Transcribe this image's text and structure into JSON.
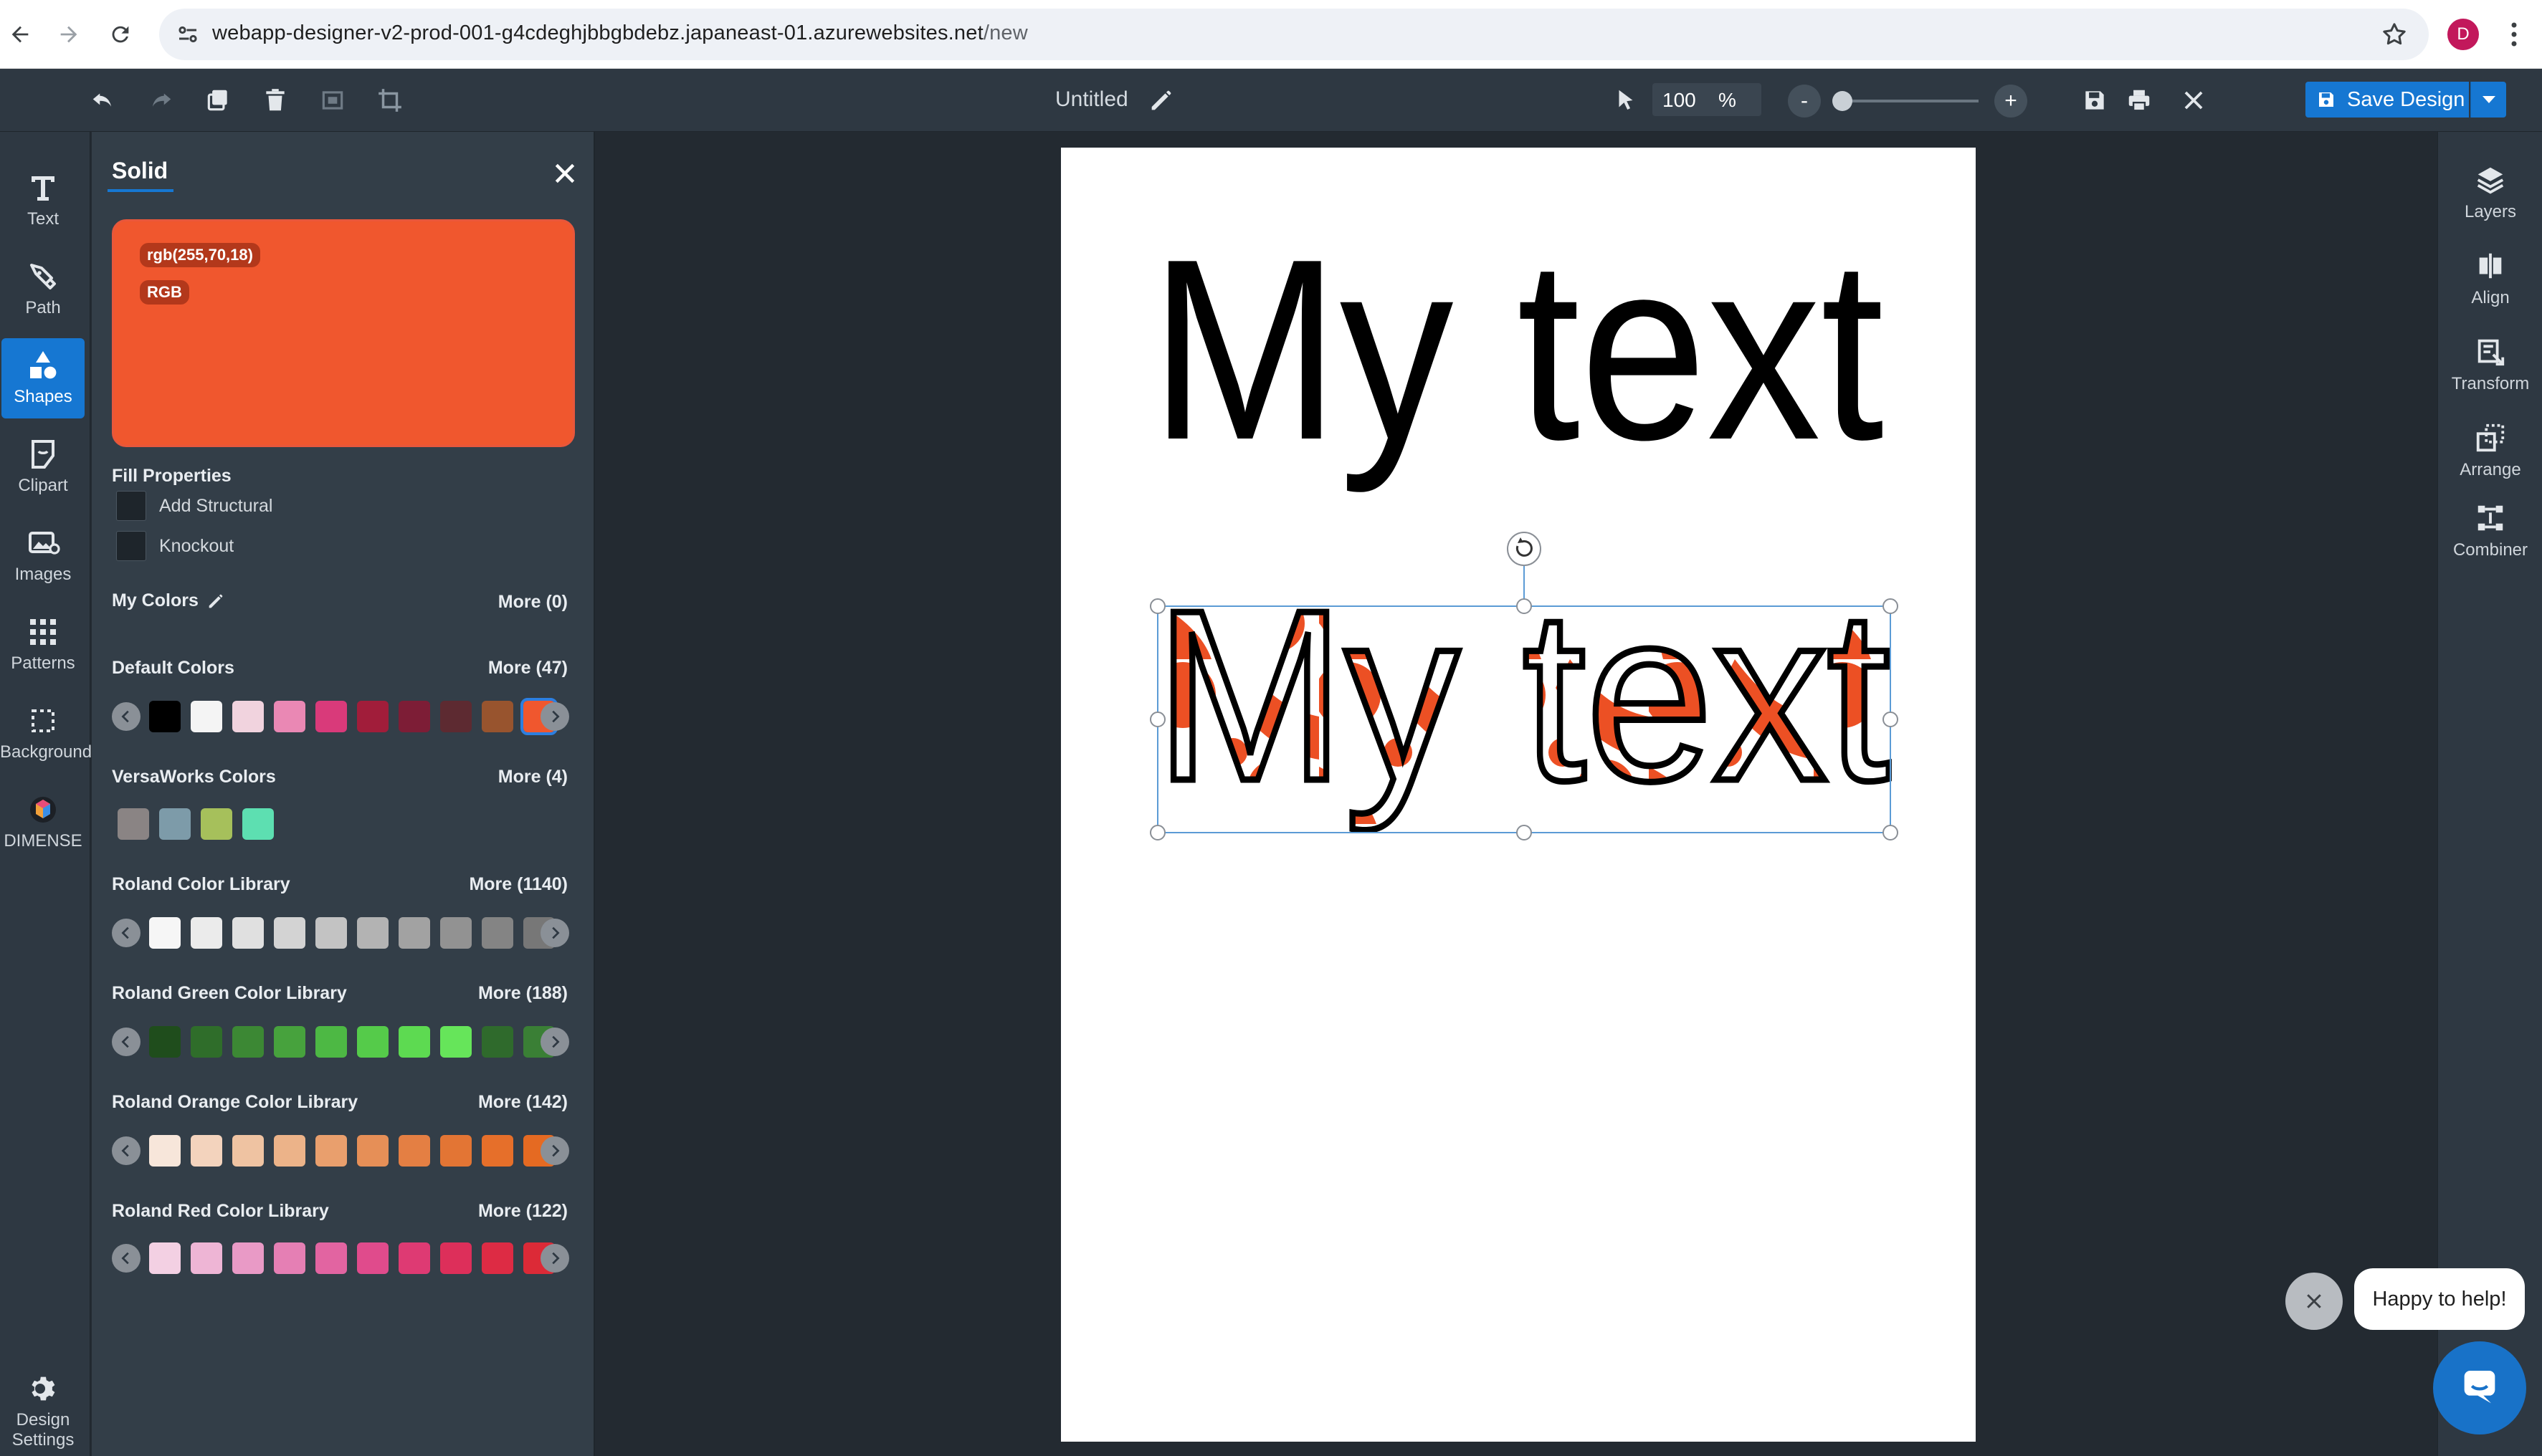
{
  "browser": {
    "url_host": "webapp-designer-v2-prod-001-g4cdeghjbbgbdebz.japaneast-01.azurewebsites.net",
    "url_path": "/new",
    "avatar_letter": "D"
  },
  "toolbar": {
    "doc_title": "Untitled",
    "zoom_value": "100",
    "zoom_unit": "%",
    "zoom_out_label": "-",
    "zoom_in_label": "+",
    "save_label": "Save Design",
    "zoom_slider_value": 0
  },
  "left_rail": {
    "items": [
      {
        "label": "Text",
        "icon": "text-icon"
      },
      {
        "label": "Path",
        "icon": "pen-icon"
      },
      {
        "label": "Shapes",
        "icon": "shapes-icon",
        "active": true
      },
      {
        "label": "Clipart",
        "icon": "clipart-icon"
      },
      {
        "label": "Images",
        "icon": "image-icon"
      },
      {
        "label": "Patterns",
        "icon": "patterns-icon"
      },
      {
        "label": "Background",
        "icon": "background-icon"
      },
      {
        "label": "DIMENSE",
        "icon": "dimense-icon"
      }
    ],
    "settings_line1": "Design",
    "settings_line2": "Settings"
  },
  "panel": {
    "title": "Solid",
    "current_color": "#f0572e",
    "color_value": "rgb(255,70,18)",
    "color_mode": "RGB",
    "fill_properties": "Fill Properties",
    "add_structural": "Add Structural",
    "knockout": "Knockout",
    "my_colors": "My Colors",
    "my_colors_more": "More (0)",
    "sections": [
      {
        "title": "Default Colors",
        "more": "More (47)",
        "arrows": true,
        "swatches": [
          "#000000",
          "#f4f4f4",
          "#f1d3de",
          "#ea88b4",
          "#d93a7a",
          "#a11d3a",
          "#7d1d36",
          "#5d2a31",
          "#98542e",
          "#f0572e"
        ],
        "selected": 9
      },
      {
        "title": "VersaWorks Colors",
        "more": "More (4)",
        "arrows": false,
        "swatches": [
          "#8a8484",
          "#7d9ba9",
          "#a6c05b",
          "#5ddfb1"
        ]
      },
      {
        "title": "Roland Color Library",
        "more": "More (1140)",
        "arrows": true,
        "swatches": [
          "#f6f6f6",
          "#ebebeb",
          "#e0e0e0",
          "#d3d3d3",
          "#c3c3c3",
          "#b3b3b3",
          "#a2a2a2",
          "#929292",
          "#848484",
          "#777777"
        ]
      },
      {
        "title": "Roland Green Color Library",
        "more": "More (188)",
        "arrows": true,
        "swatches": [
          "#1f4d1c",
          "#2f6d2a",
          "#3c8834",
          "#47a23d",
          "#4db844",
          "#55cb4a",
          "#5dda51",
          "#66e55a",
          "#2f6a2c",
          "#3a7f35"
        ]
      },
      {
        "title": "Roland Orange Color Library",
        "more": "More (142)",
        "arrows": true,
        "swatches": [
          "#f7e6da",
          "#f3d3bd",
          "#efc3a2",
          "#ecb389",
          "#e99f6d",
          "#e68f57",
          "#e47f43",
          "#e37534",
          "#e66f2a",
          "#e56a22"
        ]
      },
      {
        "title": "Roland Red Color Library",
        "more": "More (122)",
        "arrows": true,
        "swatches": [
          "#f3d0e3",
          "#eeb5d5",
          "#e99ac6",
          "#e57fb4",
          "#e264a1",
          "#e04b8c",
          "#de3a73",
          "#dd2f5a",
          "#dd2b44",
          "#dc2a37"
        ]
      }
    ]
  },
  "canvas": {
    "text_plain": "My text",
    "text_patterned": "My text"
  },
  "right_rail": {
    "items": [
      {
        "label": "Layers",
        "icon": "layers-icon"
      },
      {
        "label": "Align",
        "icon": "align-icon"
      },
      {
        "label": "Transform",
        "icon": "transform-icon"
      },
      {
        "label": "Arrange",
        "icon": "arrange-icon"
      },
      {
        "label": "Combiner",
        "icon": "combiner-icon"
      }
    ]
  },
  "help": {
    "bubble_text": "Happy to help!"
  }
}
